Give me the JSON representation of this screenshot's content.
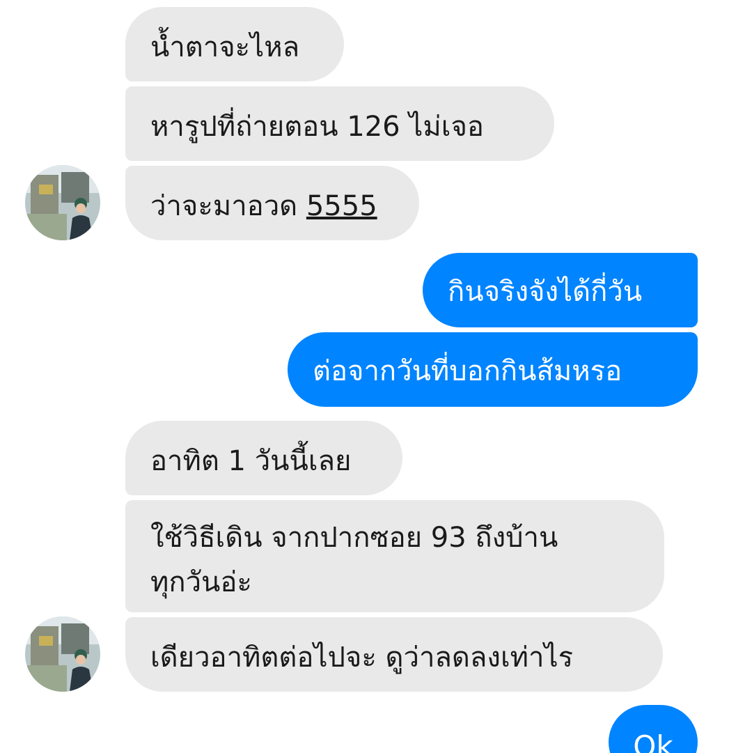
{
  "messages": [
    {
      "side": "incoming",
      "text": "น้ำตาจะไหล"
    },
    {
      "side": "incoming",
      "text": "หารูปที่ถ่ายตอน 126 ไม่เจอ"
    },
    {
      "side": "incoming",
      "prefix": "ว่าจะมาอวด ",
      "link": "5555"
    },
    {
      "side": "outgoing",
      "text": "กินจริงจังได้กี่วัน"
    },
    {
      "side": "outgoing",
      "text": "ต่อจากวันที่บอกกินส้มหรอ"
    },
    {
      "side": "incoming",
      "text": "อาทิต 1 วันนี้เลย"
    },
    {
      "side": "incoming",
      "line1": "ใช้วิธีเดิน จากปากซอย 93 ถึงบ้าน",
      "line2": "ทุกวันอ่ะ"
    },
    {
      "side": "incoming",
      "text": "เดียวอาทิตต่อไปจะ ดูว่าลดลงเท่าไร"
    },
    {
      "side": "outgoing",
      "text": "Ok"
    }
  ],
  "colors": {
    "incoming_bubble": "#e9e9e9",
    "outgoing_bubble": "#0084ff",
    "background": "#ffffff"
  }
}
